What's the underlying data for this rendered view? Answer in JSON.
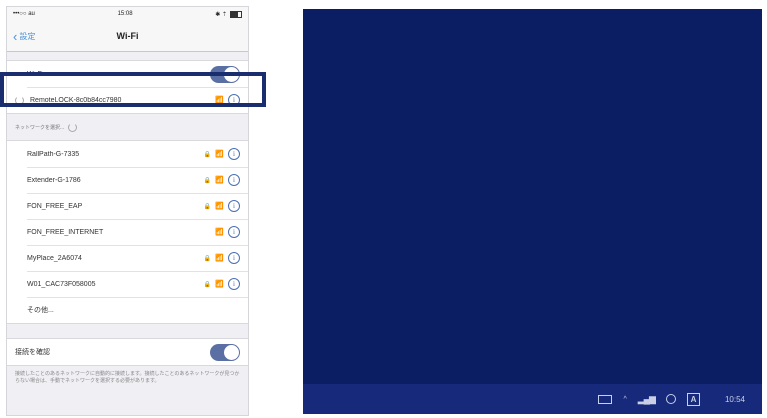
{
  "status_bar": {
    "carrier": "•••○○ au",
    "time": "15:08",
    "right": "✱ ⇡"
  },
  "nav": {
    "back_label": "設定",
    "title": "Wi-Fi"
  },
  "wifi_toggle": {
    "label": "Wi-Fi",
    "on": true
  },
  "connected_network": {
    "name": "RemoteLOCK-8c0b84cc7980"
  },
  "network_section_header": "ネットワークを選択...",
  "networks": [
    {
      "name": "RallPath-G-7335",
      "locked": true
    },
    {
      "name": "Extender-G-1786",
      "locked": true
    },
    {
      "name": "FON_FREE_EAP",
      "locked": true
    },
    {
      "name": "FON_FREE_INTERNET",
      "locked": false
    },
    {
      "name": "MyPlace_2A6074",
      "locked": true
    },
    {
      "name": "W01_CAC73F058005",
      "locked": true
    }
  ],
  "other_label": "その他...",
  "ask_to_join": {
    "label": "接続を確認",
    "on": true
  },
  "footer_text": "接続したことのあるネットワークに自動的に接続します。接続したことのあるネットワークが見つからない場合は、手動でネットワークを選択する必要があります。",
  "taskbar": {
    "clock": "10:54",
    "ime": "A"
  },
  "colors": {
    "desktop": "#0c1e63",
    "highlight": "#1a2d6e",
    "toggle": "#5a6fa3"
  }
}
